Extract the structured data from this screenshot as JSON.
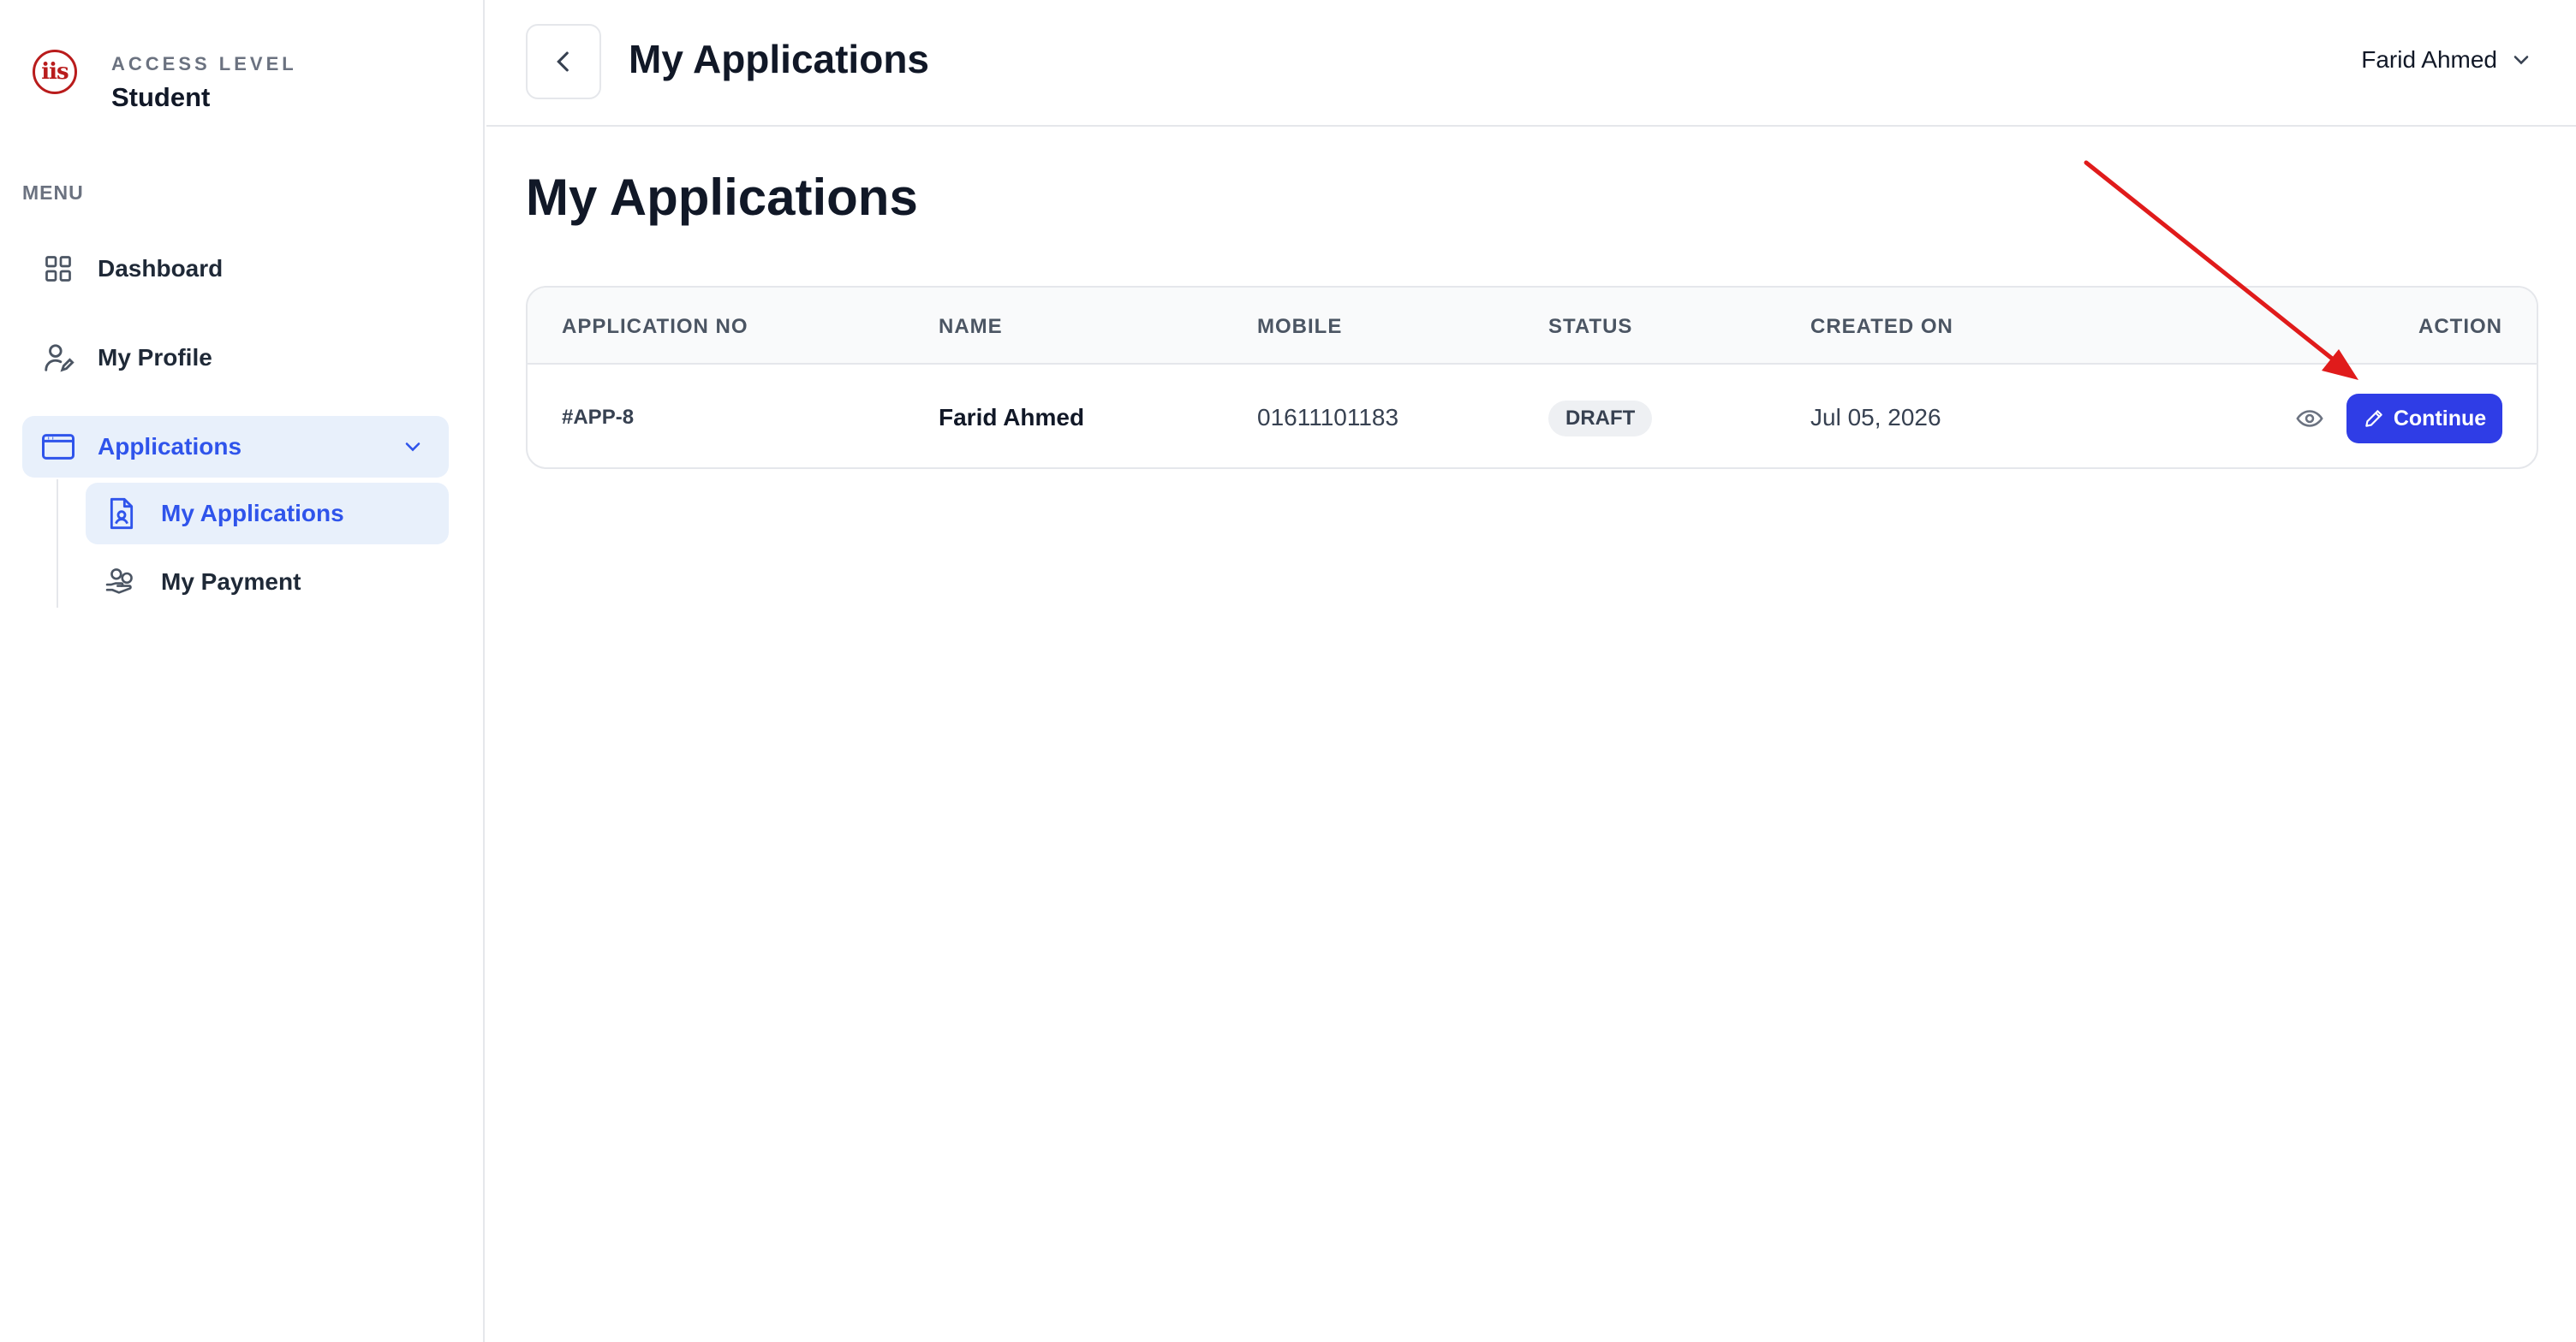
{
  "sidebar": {
    "logo_text": "iis",
    "access_label": "ACCESS LEVEL",
    "access_value": "Student",
    "menu_label": "MENU",
    "items": [
      {
        "label": "Dashboard",
        "icon": "grid-icon"
      },
      {
        "label": "My Profile",
        "icon": "user-edit-icon"
      },
      {
        "label": "Applications",
        "icon": "browser-window-icon",
        "active": true,
        "expanded": true
      }
    ],
    "subitems": [
      {
        "label": "My Applications",
        "icon": "document-user-icon",
        "active": true
      },
      {
        "label": "My Payment",
        "icon": "hand-coins-icon"
      }
    ]
  },
  "header": {
    "title": "My Applications",
    "user_name": "Farid Ahmed"
  },
  "main": {
    "page_title": "My Applications",
    "table": {
      "columns": [
        "APPLICATION NO",
        "NAME",
        "MOBILE",
        "STATUS",
        "CREATED ON",
        "ACTION"
      ],
      "rows": [
        {
          "application_no": "#APP-8",
          "name": "Farid Ahmed",
          "mobile": "01611101183",
          "status": "DRAFT",
          "created_on": "Jul 05, 2026",
          "action_label": "Continue"
        }
      ]
    }
  },
  "colors": {
    "accent": "#2f3de6",
    "active_bg": "#e8f0fb",
    "active_text": "#2f54eb",
    "annotation_arrow": "#e01b1b",
    "logo": "#b91c1c"
  }
}
